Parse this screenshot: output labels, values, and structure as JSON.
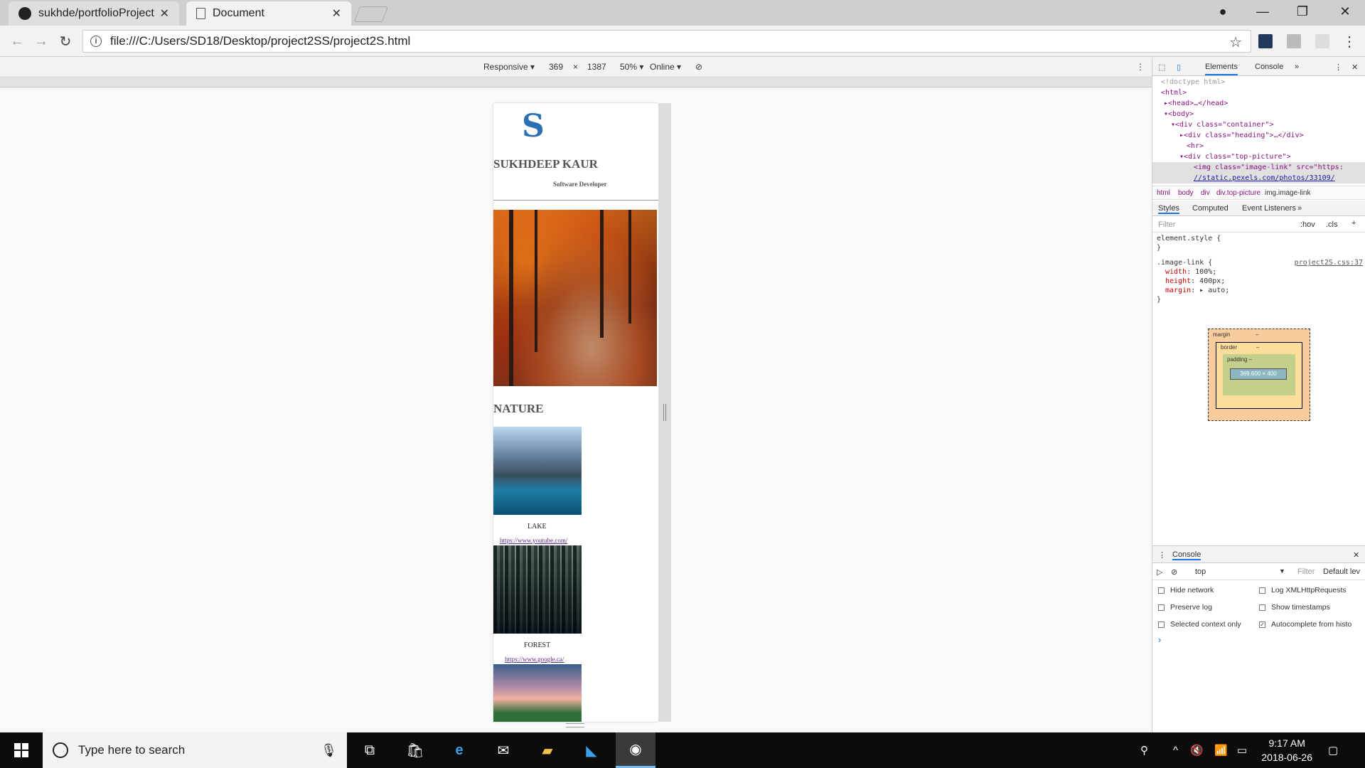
{
  "browser": {
    "tabs": [
      {
        "label": "sukhde/portfolioProject",
        "icon": "github-icon"
      },
      {
        "label": "Document",
        "icon": "document-icon"
      }
    ],
    "url": "file:///C:/Users/SD18/Desktop/project2SS/project2S.html"
  },
  "device_toolbar": {
    "mode": "Responsive ▾",
    "width": "369",
    "times": "×",
    "height": "1387",
    "zoom": "50% ▾",
    "network": "Online ▾"
  },
  "page": {
    "name": "SUKHDEEP KAUR",
    "role": "Software Developer",
    "section_title": "NATURE",
    "cards": [
      {
        "caption": "LAKE",
        "link": "https://www.youtube.com/"
      },
      {
        "caption": "FOREST",
        "link": "https://www.google.ca/"
      }
    ]
  },
  "devtools": {
    "tabs": {
      "elements": "Elements",
      "console": "Console",
      "more": "»"
    },
    "tree": {
      "doctype": "<!doctype html>",
      "html": "<html>",
      "head": "▸<head>…</head>",
      "body": "▾<body>",
      "container": "▾<div class=\"container\">",
      "heading": "▸<div class=\"heading\">…</div>",
      "hr": "<hr>",
      "top_picture": "▾<div class=\"top-picture\">",
      "img_line1": "<img class=\"image-link\" src=\"https:",
      "img_line2": "//static.pexels.com/photos/33109/"
    },
    "breadcrumbs": [
      "html",
      "body",
      "div",
      "div.top-picture",
      "img.image-link"
    ],
    "subtabs": {
      "styles": "Styles",
      "computed": "Computed",
      "listeners": "Event Listeners",
      "more": "»"
    },
    "filter": {
      "placeholder": "Filter",
      "hov": ":hov",
      "cls": ".cls",
      "plus": "+"
    },
    "styles": {
      "element_style": "element.style {",
      "close": "}",
      "selector": ".image-link {",
      "source": "project2S.css:37",
      "rules": [
        {
          "prop": "width",
          "value": "100%;"
        },
        {
          "prop": "height",
          "value": "400px;"
        },
        {
          "prop": "margin",
          "value": "▸ auto;"
        }
      ]
    },
    "box_model": {
      "margin": "margin",
      "border": "border",
      "padding": "padding –",
      "content": "369.600 × 400",
      "dash": "–"
    },
    "console": {
      "title": "Console",
      "context": "top",
      "filter": "Filter",
      "levels": "Default lev",
      "options": [
        {
          "label": "Hide network",
          "checked": false
        },
        {
          "label": "Log XMLHttpRequests",
          "checked": false
        },
        {
          "label": "Preserve log",
          "checked": false
        },
        {
          "label": "Show timestamps",
          "checked": false
        },
        {
          "label": "Selected context only",
          "checked": false
        },
        {
          "label": "Autocomplete from histo",
          "checked": true
        }
      ],
      "prompt": "›"
    }
  },
  "taskbar": {
    "search_placeholder": "Type here to search",
    "time": "9:17 AM",
    "date": "2018-06-26"
  }
}
